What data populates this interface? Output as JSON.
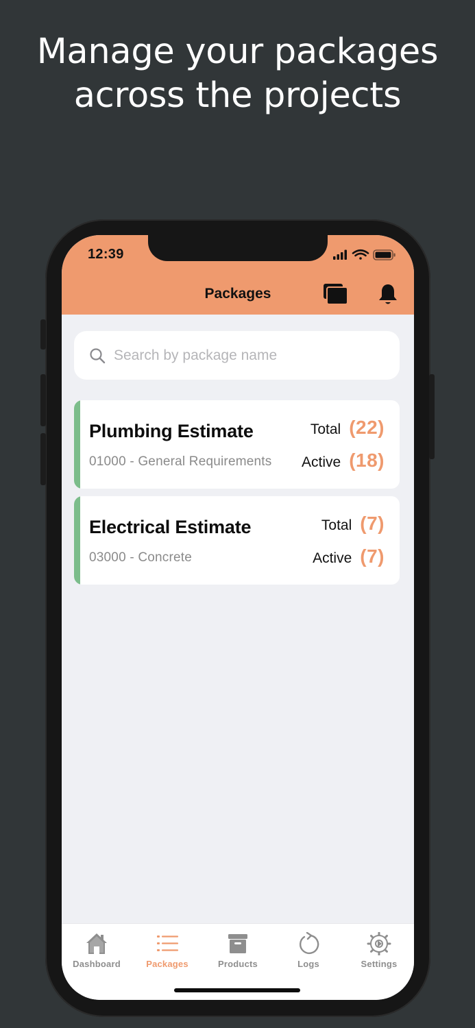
{
  "headline": {
    "line1": "Manage your packages",
    "line2": "across the projects"
  },
  "status_bar": {
    "time": "12:39",
    "icons": [
      "signal-icon",
      "wifi-icon",
      "battery-icon"
    ]
  },
  "nav": {
    "title": "Packages",
    "actions": [
      {
        "icon": "projects-stack-icon"
      },
      {
        "icon": "bell-icon"
      }
    ]
  },
  "search": {
    "placeholder": "Search by package name",
    "value": ""
  },
  "packages": [
    {
      "name": "Plumbing Estimate",
      "code": "01000 - General Requirements",
      "total_label": "Total",
      "total": "(22)",
      "active_label": "Active",
      "active": "(18)"
    },
    {
      "name": "Electrical Estimate",
      "code": "03000 - Concrete",
      "total_label": "Total",
      "total": "(7)",
      "active_label": "Active",
      "active": "(7)"
    }
  ],
  "tabs": [
    {
      "label": "Dashboard",
      "icon": "home-icon",
      "active": false
    },
    {
      "label": "Packages",
      "icon": "list-icon",
      "active": true
    },
    {
      "label": "Products",
      "icon": "archive-box-icon",
      "active": false
    },
    {
      "label": "Logs",
      "icon": "refresh-icon",
      "active": false
    },
    {
      "label": "Settings",
      "icon": "gear-icon",
      "active": false
    }
  ],
  "colors": {
    "accent": "#ef9a6e",
    "background": "#313638",
    "card_bar": "#7cbd8b",
    "screen_bg": "#eff0f4"
  }
}
